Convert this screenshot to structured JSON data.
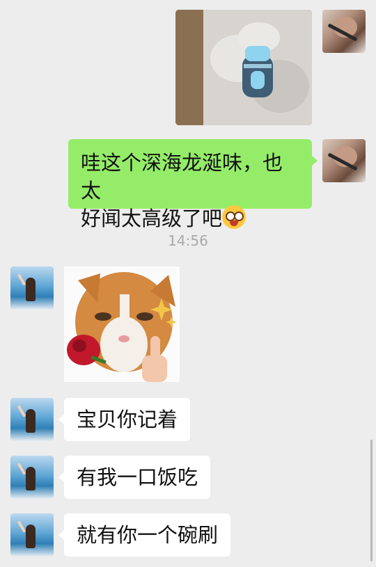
{
  "messages": [
    {
      "type": "image",
      "from": "me",
      "description": "photo"
    },
    {
      "type": "text",
      "from": "me",
      "line1": "哇这个深海龙涎味，也太",
      "line2": "好闻太高级了吧"
    },
    {
      "type": "time",
      "text": "14:56"
    },
    {
      "type": "sticker",
      "from": "her"
    },
    {
      "type": "text",
      "from": "her",
      "text": "宝贝你记着"
    },
    {
      "type": "text",
      "from": "her",
      "text": "有我一口饭吃"
    },
    {
      "type": "text",
      "from": "her",
      "text": "就有你一个碗刷"
    }
  ],
  "colors": {
    "background": "#ededed",
    "my_bubble": "#95ec69",
    "their_bubble": "#ffffff",
    "timestamp": "#a9a9a9"
  },
  "icons": {
    "emoji": "star-struck-emoji-icon"
  }
}
